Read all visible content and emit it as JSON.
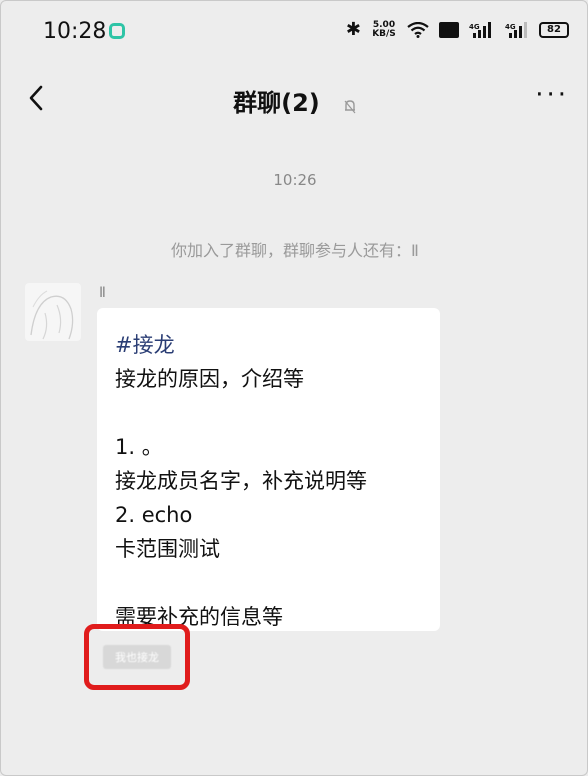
{
  "status_bar": {
    "time": "10:28",
    "net_speed": "5.00\nKB/S",
    "nfc": "NFC",
    "signal1": "4G",
    "signal2": "4G",
    "battery": "82"
  },
  "nav": {
    "title": "群聊(2)",
    "more": "···"
  },
  "chat": {
    "timestamp": "10:26",
    "system_message": "你加入了群聊，群聊参与人还有：Ⅱ",
    "sender_name": "Ⅱ",
    "message_lines": [
      "#接龙",
      "接龙的原因，介绍等",
      "",
      "1. 。",
      "接龙成员名字，补充说明等",
      "2. echo",
      "卡范围测试",
      "",
      "需要补充的信息等"
    ],
    "action_button_label": "我也接龙"
  },
  "colors": {
    "highlight_border": "#e01c1c",
    "hashtag": "#2a3d74",
    "app_badge": "#2ec4a6"
  }
}
